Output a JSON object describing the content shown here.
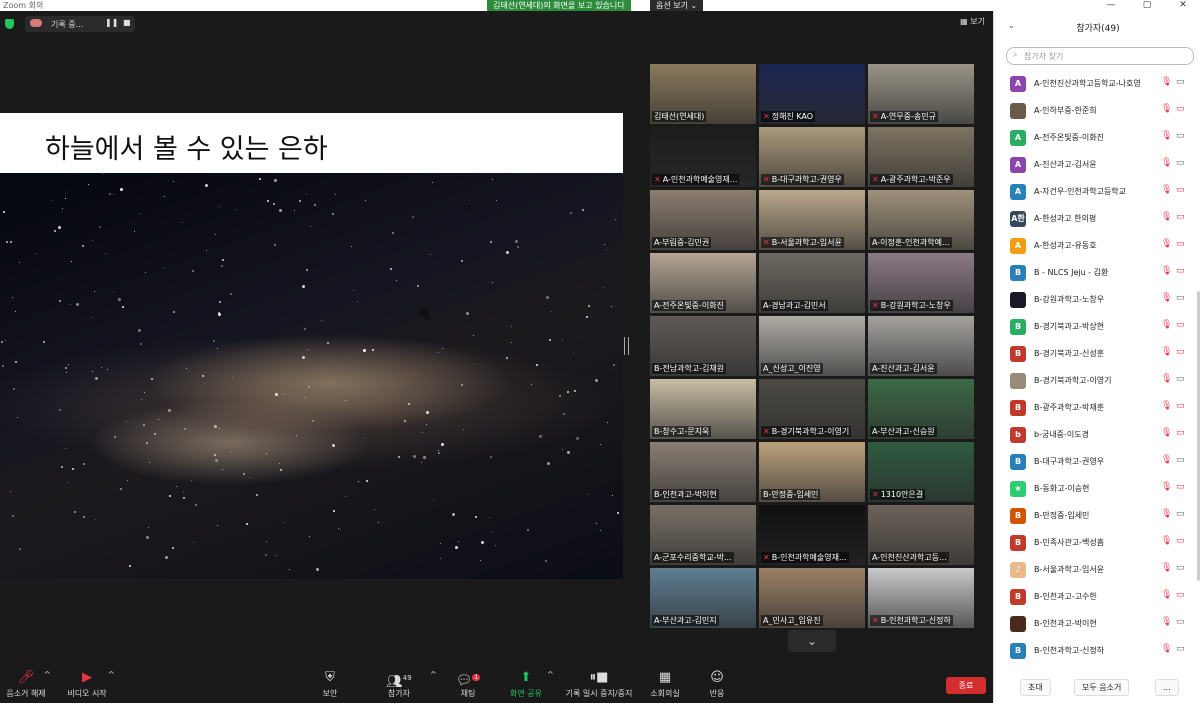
{
  "window": {
    "title": "Zoom 회의",
    "sharing_banner": "김태선(연세대)의 화면을 보고 있습니다",
    "view_options": "옵션 보기 ⌄",
    "controls": [
      "—",
      "▢",
      "✕"
    ]
  },
  "meeting": {
    "recording_label": "기록 중...",
    "pause_symbol": "❚❚",
    "stop_symbol": "■",
    "view_label": "보기"
  },
  "slide": {
    "title": "하늘에서 볼 수 있는 은하"
  },
  "tiles": [
    {
      "name": "김태선(연세대)",
      "muted": false,
      "active": true,
      "color": "#8a7a5c"
    },
    {
      "name": "정해진 KAO",
      "muted": true,
      "active": false,
      "color": "#1c2550"
    },
    {
      "name": "A-연무중-송민규",
      "muted": true,
      "active": false,
      "color": "#9a9487"
    },
    {
      "name": "A-인천과학예술영재...",
      "muted": true,
      "active": false,
      "color": "#1d1d1d"
    },
    {
      "name": "B-대구과학고-권영우",
      "muted": true,
      "active": false,
      "color": "#a99a7a"
    },
    {
      "name": "A-광주과학고-박준우",
      "muted": true,
      "active": false,
      "color": "#7d7362"
    },
    {
      "name": "A-부림중-김민권",
      "muted": false,
      "active": false,
      "color": "#8b7d6e"
    },
    {
      "name": "B-서울과학고-임서윤",
      "muted": true,
      "active": false,
      "color": "#bba88a"
    },
    {
      "name": "A-이정훈-인천과학예...",
      "muted": false,
      "active": false,
      "color": "#9f927c"
    },
    {
      "name": "A-전주온빛중-이화진",
      "muted": false,
      "active": false,
      "color": "#b4a595"
    },
    {
      "name": "A-경남과고-김민서",
      "muted": false,
      "active": false,
      "color": "#6f6a62"
    },
    {
      "name": "B-강원과학고-노창우",
      "muted": true,
      "active": false,
      "color": "#8c7a86"
    },
    {
      "name": "B-전남과학고-김채원",
      "muted": false,
      "active": false,
      "color": "#5f5a55"
    },
    {
      "name": "A_신성고_이진영",
      "muted": false,
      "active": false,
      "color": "#b0aca6"
    },
    {
      "name": "A-진산과고-김서윤",
      "muted": false,
      "active": false,
      "color": "#a5a29e"
    },
    {
      "name": "B-창수고-문지욱",
      "muted": false,
      "active": false,
      "color": "#c8bda5"
    },
    {
      "name": "B-경기북과학고-이영기",
      "muted": true,
      "active": false,
      "color": "#4d4a45"
    },
    {
      "name": "A-부산과고-신승원",
      "muted": false,
      "active": false,
      "color": "#3b6a45"
    },
    {
      "name": "B-인천과고-박이현",
      "muted": false,
      "active": false,
      "color": "#8a7f74"
    },
    {
      "name": "B-만정중-임세민",
      "muted": false,
      "active": false,
      "color": "#bca27c"
    },
    {
      "name": "1310안은결",
      "muted": true,
      "active": false,
      "color": "#2e5a40"
    },
    {
      "name": "A-군포수리중학교-박...",
      "muted": false,
      "active": false,
      "color": "#777066"
    },
    {
      "name": "B-인천과학예술영재...",
      "muted": true,
      "active": false,
      "color": "#0f0f0f"
    },
    {
      "name": "A-인천진산과학고등...",
      "muted": false,
      "active": false,
      "color": "#6d635a"
    },
    {
      "name": "A-부산과고-김민지",
      "muted": false,
      "active": false,
      "color": "#5f7f93"
    },
    {
      "name": "A_민사고_임유진",
      "muted": false,
      "active": false,
      "color": "#9c8067"
    },
    {
      "name": "B-인천과학고-신정하",
      "muted": true,
      "active": false,
      "color": "#c9c9c9"
    }
  ],
  "toolbar": {
    "unmute": "음소거 해제",
    "video": "비디오 시작",
    "security": "보안",
    "participants": "참가자",
    "participants_count": "49",
    "chat": "채팅",
    "chat_badge": "1",
    "share": "화면 공유",
    "pause_record": "기록 일시 중지/중지",
    "breakout": "소회의실",
    "reactions": "반응",
    "end": "종료",
    "caret": "^"
  },
  "panel": {
    "title": "참가자(49)",
    "collapse": "⌄",
    "search_placeholder": "참가자 찾기",
    "participants": [
      {
        "initial": "A",
        "name": "A-인천진산과학고등학교-나호영",
        "color": "#8e44ad",
        "video_off": false
      },
      {
        "initial": "",
        "name": "A-인하부중-한준희",
        "color": "#6b5a4a",
        "video_off": true
      },
      {
        "initial": "A",
        "name": "A-전주온빛중-이화진",
        "color": "#27ae60",
        "video_off": false
      },
      {
        "initial": "A",
        "name": "A-진산과고-김서윤",
        "color": "#8e44ad",
        "video_off": false
      },
      {
        "initial": "A",
        "name": "A-자건우-인천과학고등학교",
        "color": "#2980b9",
        "video_off": true
      },
      {
        "initial": "A한",
        "name": "A-한성과고 한의평",
        "color": "#34495e",
        "video_off": true
      },
      {
        "initial": "A",
        "name": "A-한성과고-유동호",
        "color": "#f39c12",
        "video_off": true
      },
      {
        "initial": "B",
        "name": "B - NLCS Jeju - 김환",
        "color": "#2980b9",
        "video_off": true
      },
      {
        "initial": "",
        "name": "B-강원과학고-노창우",
        "color": "#1a1a2a",
        "video_off": false
      },
      {
        "initial": "B",
        "name": "B-경기북과고-박상현",
        "color": "#27ae60",
        "video_off": true
      },
      {
        "initial": "B",
        "name": "B-경기북과고-신성훈",
        "color": "#c0392b",
        "video_off": true
      },
      {
        "initial": "",
        "name": "B-경기북과학고-이영기",
        "color": "#9a8a7a",
        "video_off": false
      },
      {
        "initial": "B",
        "name": "B-광주과학고-박재훈",
        "color": "#c0392b",
        "video_off": true
      },
      {
        "initial": "b",
        "name": "b-궁내중-이도경",
        "color": "#c0392b",
        "video_off": true
      },
      {
        "initial": "B",
        "name": "B-대구과학고-권영우",
        "color": "#2980b9",
        "video_off": false
      },
      {
        "initial": "★",
        "name": "B-동화고-이승현",
        "color": "#2ecc71",
        "video_off": true
      },
      {
        "initial": "B",
        "name": "B-만정중-임세민",
        "color": "#d35400",
        "video_off": false
      },
      {
        "initial": "B",
        "name": "B-민족사관고-백성흠",
        "color": "#c0392b",
        "video_off": true
      },
      {
        "initial": "♪",
        "name": "B-서울과학고-임서윤",
        "color": "#e8b98a",
        "video_off": false
      },
      {
        "initial": "B",
        "name": "B-인천과고-고수한",
        "color": "#c0392b",
        "video_off": true
      },
      {
        "initial": "",
        "name": "B-인천과고-박이현",
        "color": "#4a2a1a",
        "video_off": false
      },
      {
        "initial": "B",
        "name": "B-인천과학고-신정하",
        "color": "#2980b9",
        "video_off": false
      }
    ],
    "footer": {
      "invite": "초대",
      "mute_all": "모두 음소거",
      "more": "..."
    }
  },
  "icons": {
    "mic_muted": "mic-muted-icon",
    "video_off": "video-off-icon",
    "shield": "shield-icon",
    "search": "search-icon"
  }
}
